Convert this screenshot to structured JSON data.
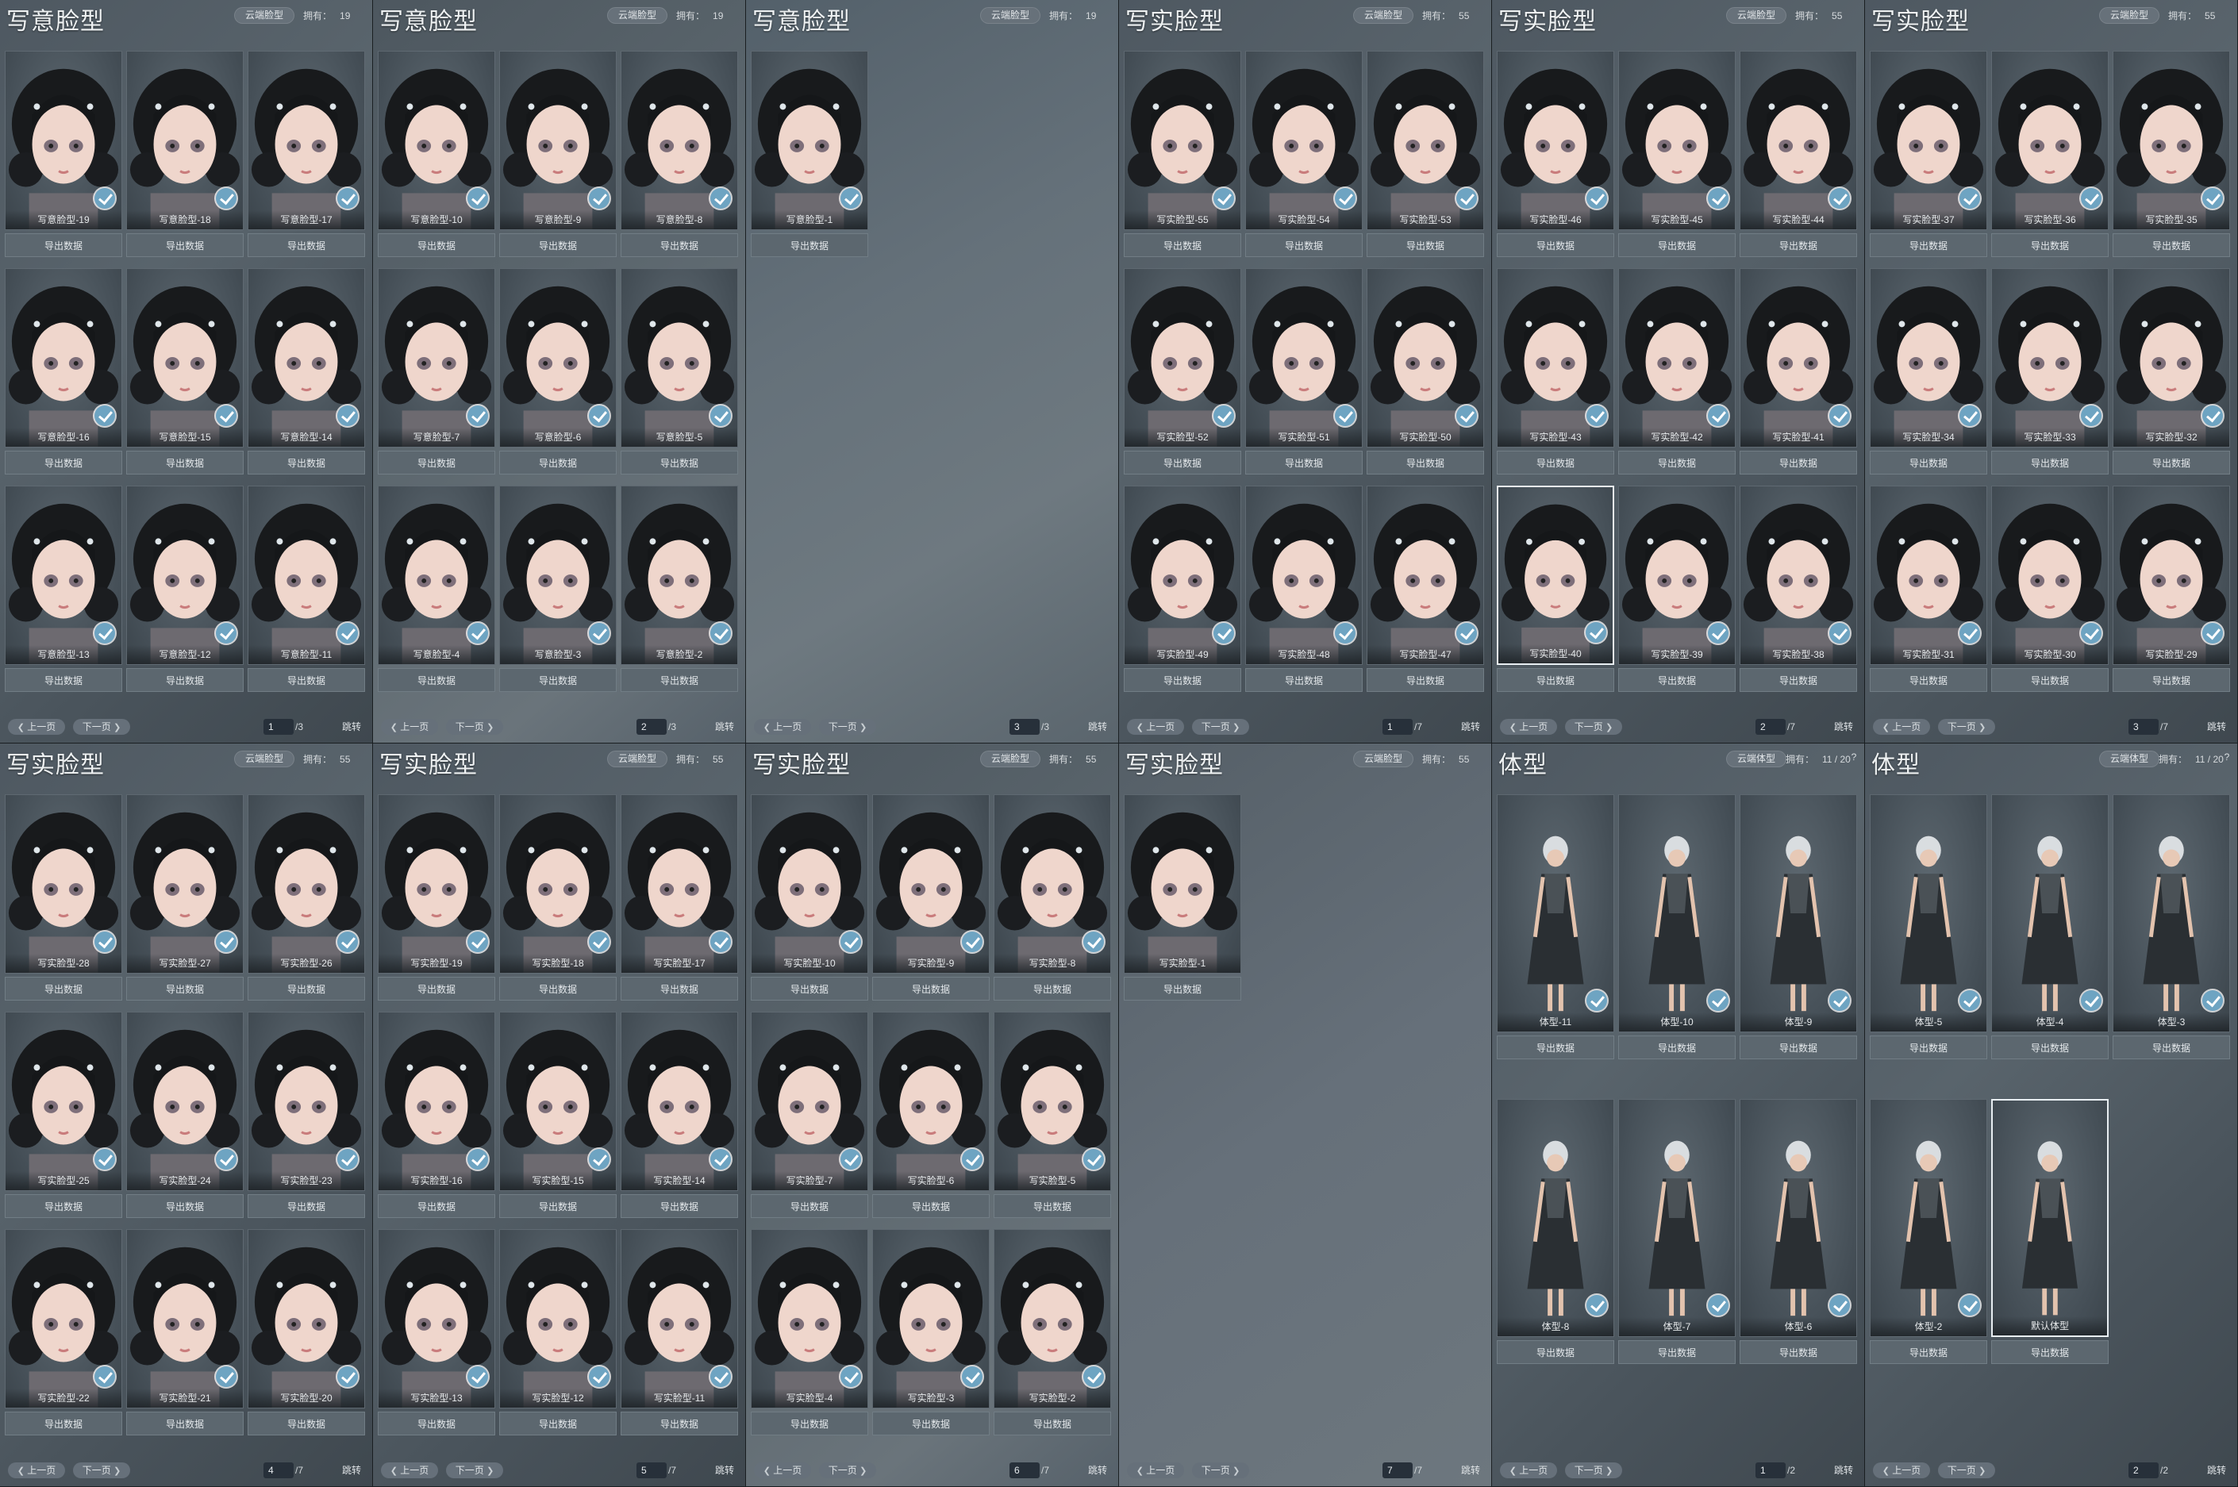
{
  "common": {
    "owned_label": "拥有：",
    "export_label": "导出数据",
    "prev_label": "上一页",
    "next_label": "下一页",
    "jump_label": "跳转",
    "help_label": "?"
  },
  "colors": {
    "check_badge": "#6ea4c2",
    "panel_bg": "#59646c",
    "title_text": "#eef1f2"
  },
  "icons": {
    "check": "check-icon",
    "prev": "chevron-left-icon",
    "next": "chevron-right-icon"
  },
  "panels": [
    {
      "title": "写意脸型",
      "cloud_label": "云端脸型",
      "owned": "19",
      "page": "1",
      "total": "/3",
      "items": [
        {
          "label": "写意脸型-19",
          "checked": true
        },
        {
          "label": "写意脸型-18",
          "checked": true
        },
        {
          "label": "写意脸型-17",
          "checked": true
        },
        {
          "label": "写意脸型-16",
          "checked": true
        },
        {
          "label": "写意脸型-15",
          "checked": true
        },
        {
          "label": "写意脸型-14",
          "checked": true
        },
        {
          "label": "写意脸型-13",
          "checked": true
        },
        {
          "label": "写意脸型-12",
          "checked": true
        },
        {
          "label": "写意脸型-11",
          "checked": true
        }
      ]
    },
    {
      "title": "写意脸型",
      "cloud_label": "云端脸型",
      "owned": "19",
      "page": "2",
      "total": "/3",
      "items": [
        {
          "label": "写意脸型-10",
          "checked": true
        },
        {
          "label": "写意脸型-9",
          "checked": true
        },
        {
          "label": "写意脸型-8",
          "checked": true
        },
        {
          "label": "写意脸型-7",
          "checked": true
        },
        {
          "label": "写意脸型-6",
          "checked": true
        },
        {
          "label": "写意脸型-5",
          "checked": true
        },
        {
          "label": "写意脸型-4",
          "checked": true
        },
        {
          "label": "写意脸型-3",
          "checked": true
        },
        {
          "label": "写意脸型-2",
          "checked": true
        }
      ]
    },
    {
      "title": "写意脸型",
      "cloud_label": "云端脸型",
      "owned": "19",
      "page": "3",
      "total": "/3",
      "items": [
        {
          "label": "写意脸型-1",
          "checked": true
        }
      ]
    },
    {
      "title": "写实脸型",
      "cloud_label": "云端脸型",
      "owned": "55",
      "page": "1",
      "total": "/7",
      "items": [
        {
          "label": "写实脸型-55",
          "checked": true
        },
        {
          "label": "写实脸型-54",
          "checked": true
        },
        {
          "label": "写实脸型-53",
          "checked": true
        },
        {
          "label": "写实脸型-52",
          "checked": true
        },
        {
          "label": "写实脸型-51",
          "checked": true
        },
        {
          "label": "写实脸型-50",
          "checked": true
        },
        {
          "label": "写实脸型-49",
          "checked": true
        },
        {
          "label": "写实脸型-48",
          "checked": true
        },
        {
          "label": "写实脸型-47",
          "checked": true
        }
      ]
    },
    {
      "title": "写实脸型",
      "cloud_label": "云端脸型",
      "owned": "55",
      "page": "2",
      "total": "/7",
      "items": [
        {
          "label": "写实脸型-46",
          "checked": true
        },
        {
          "label": "写实脸型-45",
          "checked": true
        },
        {
          "label": "写实脸型-44",
          "checked": true
        },
        {
          "label": "写实脸型-43",
          "checked": true
        },
        {
          "label": "写实脸型-42",
          "checked": true
        },
        {
          "label": "写实脸型-41",
          "checked": true
        },
        {
          "label": "写实脸型-40",
          "checked": true,
          "selected": true
        },
        {
          "label": "写实脸型-39",
          "checked": true
        },
        {
          "label": "写实脸型-38",
          "checked": true
        }
      ]
    },
    {
      "title": "写实脸型",
      "cloud_label": "云端脸型",
      "owned": "55",
      "page": "3",
      "total": "/7",
      "items": [
        {
          "label": "写实脸型-37",
          "checked": true
        },
        {
          "label": "写实脸型-36",
          "checked": true
        },
        {
          "label": "写实脸型-35",
          "checked": true
        },
        {
          "label": "写实脸型-34",
          "checked": true
        },
        {
          "label": "写实脸型-33",
          "checked": true
        },
        {
          "label": "写实脸型-32",
          "checked": true
        },
        {
          "label": "写实脸型-31",
          "checked": true
        },
        {
          "label": "写实脸型-30",
          "checked": true
        },
        {
          "label": "写实脸型-29",
          "checked": true
        }
      ]
    },
    {
      "title": "写实脸型",
      "cloud_label": "云端脸型",
      "owned": "55",
      "page": "4",
      "total": "/7",
      "items": [
        {
          "label": "写实脸型-28",
          "checked": true
        },
        {
          "label": "写实脸型-27",
          "checked": true
        },
        {
          "label": "写实脸型-26",
          "checked": true
        },
        {
          "label": "写实脸型-25",
          "checked": true
        },
        {
          "label": "写实脸型-24",
          "checked": true
        },
        {
          "label": "写实脸型-23",
          "checked": true
        },
        {
          "label": "写实脸型-22",
          "checked": true
        },
        {
          "label": "写实脸型-21",
          "checked": true
        },
        {
          "label": "写实脸型-20",
          "checked": true
        }
      ]
    },
    {
      "title": "写实脸型",
      "cloud_label": "云端脸型",
      "owned": "55",
      "page": "5",
      "total": "/7",
      "items": [
        {
          "label": "写实脸型-19",
          "checked": true
        },
        {
          "label": "写实脸型-18",
          "checked": true
        },
        {
          "label": "写实脸型-17",
          "checked": true
        },
        {
          "label": "写实脸型-16",
          "checked": true
        },
        {
          "label": "写实脸型-15",
          "checked": true
        },
        {
          "label": "写实脸型-14",
          "checked": true
        },
        {
          "label": "写实脸型-13",
          "checked": true
        },
        {
          "label": "写实脸型-12",
          "checked": true
        },
        {
          "label": "写实脸型-11",
          "checked": true
        }
      ]
    },
    {
      "title": "写实脸型",
      "cloud_label": "云端脸型",
      "owned": "55",
      "page": "6",
      "total": "/7",
      "items": [
        {
          "label": "写实脸型-10",
          "checked": true
        },
        {
          "label": "写实脸型-9",
          "checked": true
        },
        {
          "label": "写实脸型-8",
          "checked": true
        },
        {
          "label": "写实脸型-7",
          "checked": true
        },
        {
          "label": "写实脸型-6",
          "checked": true
        },
        {
          "label": "写实脸型-5",
          "checked": true
        },
        {
          "label": "写实脸型-4",
          "checked": true
        },
        {
          "label": "写实脸型-3",
          "checked": true
        },
        {
          "label": "写实脸型-2",
          "checked": true
        }
      ]
    },
    {
      "title": "写实脸型",
      "cloud_label": "云端脸型",
      "owned": "55",
      "page": "7",
      "total": "/7",
      "items": [
        {
          "label": "写实脸型-1",
          "checked": false
        }
      ]
    },
    {
      "title": "体型",
      "cloud_label": "云端体型",
      "owned": "11 / 20",
      "body": true,
      "page": "1",
      "total": "/2",
      "items": [
        {
          "label": "体型-11",
          "checked": true
        },
        {
          "label": "体型-10",
          "checked": true
        },
        {
          "label": "体型-9",
          "checked": true
        },
        {
          "label": "体型-8",
          "checked": true
        },
        {
          "label": "体型-7",
          "checked": true
        },
        {
          "label": "体型-6",
          "checked": true
        }
      ]
    },
    {
      "title": "体型",
      "cloud_label": "云端体型",
      "owned": "11 / 20",
      "body": true,
      "page": "2",
      "total": "/2",
      "items": [
        {
          "label": "体型-5",
          "checked": true
        },
        {
          "label": "体型-4",
          "checked": true
        },
        {
          "label": "体型-3",
          "checked": true
        },
        {
          "label": "体型-2",
          "checked": true
        },
        {
          "label": "默认体型",
          "checked": false,
          "selected": true
        }
      ]
    }
  ]
}
